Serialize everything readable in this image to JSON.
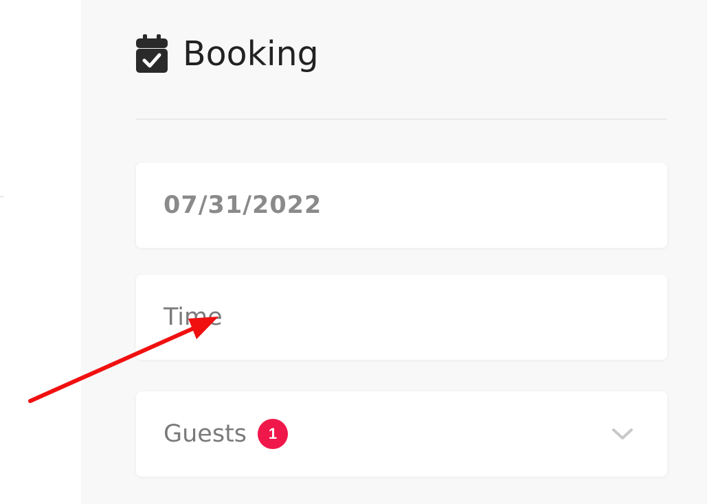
{
  "booking": {
    "title": "Booking",
    "icon": "calendar-check-icon"
  },
  "fields": {
    "date": {
      "value": "07/31/2022"
    },
    "time": {
      "placeholder": "Time"
    },
    "guests": {
      "label": "Guests",
      "count": "1",
      "icon": "chevron-down-icon"
    }
  },
  "colors": {
    "panel_background": "#f8f8f8",
    "badge": "#f0174a",
    "annotation_arrow": "#f01010",
    "field_text": "#7a7a7a",
    "title": "#222222"
  },
  "annotation": {
    "icon": "red-arrow-pointer"
  }
}
